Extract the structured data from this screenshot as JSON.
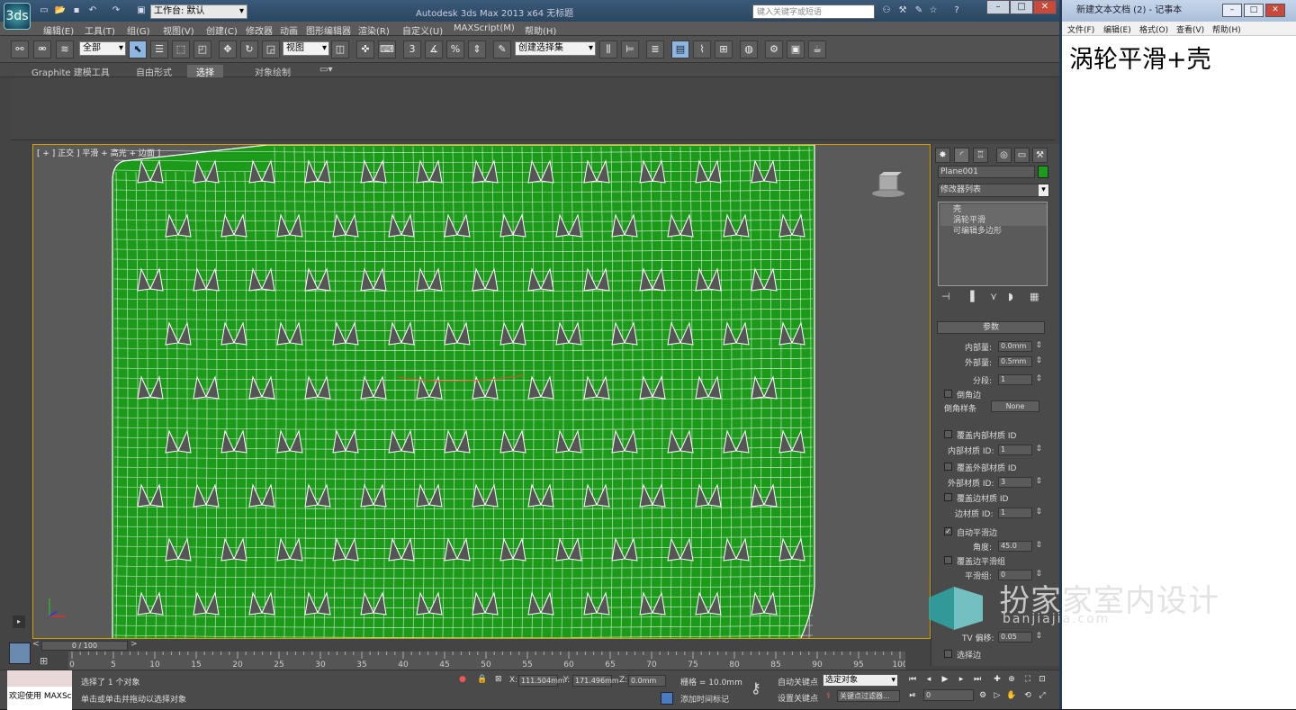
{
  "max": {
    "app_icon": "3ds",
    "workspace_label": "工作台: 默认",
    "title": "Autodesk 3ds Max  2013 x64      无标题",
    "search_placeholder": "键入关键字或短语",
    "menu": [
      "编辑(E)",
      "工具(T)",
      "组(G)",
      "视图(V)",
      "创建(C)",
      "修改器",
      "动画",
      "图形编辑器",
      "渲染(R)",
      "自定义(U)",
      "MAXScript(M)",
      "帮助(H)"
    ],
    "toolbar": {
      "filter_label": "全部",
      "ref_coord_label": "视图",
      "named_sel_label": "创建选择集",
      "snap_label": "3"
    },
    "ribbon_tabs": [
      "Graphite 建模工具",
      "自由形式",
      "选择",
      "对象绘制"
    ],
    "viewport": {
      "label": "[ + ] 正交 ] 平滑 + 高光 + 边面 ]",
      "mesh_color": "#1c9a1a"
    },
    "command_panel": {
      "object_name": "Plane001",
      "object_color": "#1b9c1b",
      "modifier_list_label": "修改器列表",
      "stack": [
        "壳",
        "涡轮平滑",
        "可编辑多边形"
      ],
      "rollout_title": "参数",
      "params": {
        "inner_label": "内部量:",
        "inner_value": "0.0mm",
        "outer_label": "外部量:",
        "outer_value": "0.5mm",
        "segments_label": "分段:",
        "segments_value": "1",
        "bevel_edges_label": "倒角边",
        "bevel_spline_label": "倒角样条",
        "bevel_spline_value": "None",
        "override_inner_label": "覆盖内部材质 ID",
        "inner_id_label": "内部材质 ID:",
        "inner_id_value": "1",
        "override_outer_label": "覆盖外部材质 ID",
        "outer_id_label": "外部材质 ID:",
        "outer_id_value": "3",
        "override_edge_label": "覆盖边材质 ID",
        "edge_id_label": "边材质 ID:",
        "edge_id_value": "1",
        "auto_smooth_label": "自动平滑边",
        "angle_label": "角度:",
        "angle_value": "45.0",
        "override_smooth_label": "覆盖边平滑组",
        "smooth_group_label": "平滑组:",
        "smooth_group_value": "0",
        "tv_offset_label": "TV 偏移:",
        "tv_offset_value": "0.05",
        "select_edges_label": "选择边"
      }
    },
    "timeline": {
      "slider_label": "0 / 100",
      "ticks": [
        "0",
        "5",
        "10",
        "15",
        "20",
        "25",
        "30",
        "35",
        "40",
        "45",
        "50",
        "55",
        "60",
        "65",
        "70",
        "75",
        "80",
        "85",
        "90",
        "95",
        "100"
      ]
    },
    "status": {
      "welcome": "欢迎使用 MAXSc",
      "selected_text": "选择了 1 个对象",
      "prompt_text": "单击或单击并拖动以选择对象",
      "x_label": "X:",
      "x_value": "111.504mm",
      "y_label": "Y:",
      "y_value": "171.496mm",
      "z_label": "Z:",
      "z_value": "0.0mm",
      "grid_text": "栅格 = 10.0mm",
      "add_time_tag": "添加时间标记",
      "auto_key": "自动关键点",
      "set_key": "设置关键点",
      "selected_dropdown": "选定对象",
      "key_filters": "关键点过滤器...",
      "frame_value": "0"
    }
  },
  "notepad": {
    "title": "新建文本文档 (2) - 记事本",
    "menu": [
      "文件(F)",
      "编辑(E)",
      "格式(O)",
      "查看(V)",
      "帮助(H)"
    ],
    "content": "涡轮平滑+壳"
  },
  "watermark": {
    "text": "扮家家室内设计",
    "url": "banjiajia.com"
  }
}
